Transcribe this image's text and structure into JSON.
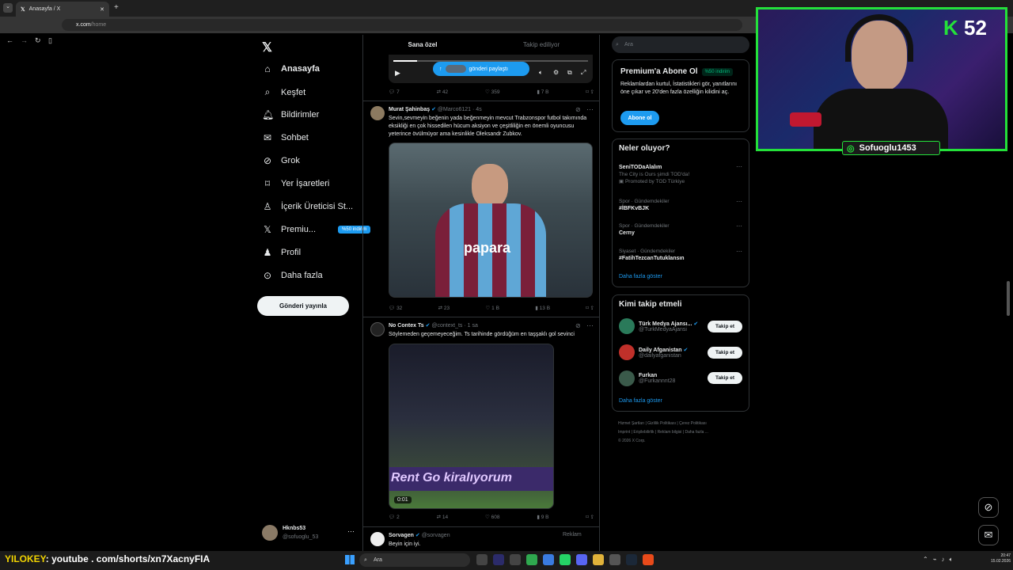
{
  "browser": {
    "tab_title": "Anasayfa / X",
    "url_host": "x.com",
    "url_path": "/home"
  },
  "nav": {
    "items": [
      {
        "label": "Anasayfa",
        "icon": "home-icon"
      },
      {
        "label": "Keşfet",
        "icon": "search-icon"
      },
      {
        "label": "Bildirimler",
        "icon": "bell-icon"
      },
      {
        "label": "Sohbet",
        "icon": "mail-icon"
      },
      {
        "label": "Grok",
        "icon": "grok-icon"
      },
      {
        "label": "Yer İşaretleri",
        "icon": "bookmark-icon"
      },
      {
        "label": "İçerik Üreticisi St...",
        "icon": "creator-icon"
      },
      {
        "label": "Premiu...",
        "icon": "x-logo-icon",
        "badge": "%50 indirim"
      },
      {
        "label": "Profil",
        "icon": "person-icon"
      },
      {
        "label": "Daha fazla",
        "icon": "more-circle-icon"
      }
    ],
    "post_button": "Gönderi yayınla",
    "account": {
      "name": "Hknbs53",
      "handle": "@sofuoglu_53"
    }
  },
  "feed": {
    "tabs": [
      "Sana özel",
      "Takip ediliyor"
    ],
    "share_pill": "gönderi paylaştı",
    "post0_actions": {
      "replies": "7",
      "reposts": "42",
      "likes": "359",
      "views": "7 B"
    },
    "post1": {
      "name": "Murat Şahinbaş",
      "handle": "@Marco6121",
      "time": "4s",
      "text": "Sevin,sevmeyin beğenin yada beğenmeyin mevcut Trabzonspor futbol takımında eksikliği en çok hissedilen hücum aksiyon ve çeşitliliğin en önemli oyuncusu yeterince övülmüyor ama kesinlikle Oleksandr Zubkov.",
      "jersey_text": "papara",
      "actions": {
        "replies": "32",
        "reposts": "23",
        "likes": "1 B",
        "views": "13 B"
      }
    },
    "post2": {
      "name": "No Contex Ts",
      "handle": "@context_ts",
      "time": "1 sa",
      "text": "Söylemeden geçemeyeceğim. Ts tarihinde gördüğüm en taşşaklı gol sevinci",
      "video_time": "0:01",
      "banner_text": "Rent Go  kiralıyorum",
      "actions": {
        "replies": "2",
        "reposts": "14",
        "likes": "608",
        "views": "9 B"
      }
    },
    "post3": {
      "name": "Sorvagen",
      "handle": "@sorvagen",
      "tag": "Reklam",
      "text": "Beyin için iyi."
    }
  },
  "right": {
    "search_placeholder": "Ara",
    "premium": {
      "title": "Premium'a Abone Ol",
      "badge": "%50 indirim",
      "text": "Reklamlardan kurtul, İstatistikleri gör, yanıtlarını öne çıkar ve 20'den fazla özelliğin kilidini aç.",
      "button": "Abone ol"
    },
    "trends_title": "Neler oluyor?",
    "promoted": {
      "title": "SeniTODaAlalım",
      "sub": "The City is Ours şimdi TOD'da!",
      "meta": "Promoted by TOD Türkiye"
    },
    "trends": [
      {
        "meta": "Spor · Gündemdekiler",
        "title": "#İBFKvBJK"
      },
      {
        "meta": "Spor · Gündemdekiler",
        "title": "Cerny"
      },
      {
        "meta": "Siyaset · Gündemdekiler",
        "title": "#FatihTezcanTutuklansın"
      }
    ],
    "trends_more": "Daha fazla göster",
    "wtf_title": "Kimi takip etmeli",
    "wtf": [
      {
        "name": "Türk Medya Ajansı...",
        "handle": "@TurkMedyaAjansi",
        "color": "#2a7a5a"
      },
      {
        "name": "Daily Afganistan",
        "handle": "@dailyafganistan",
        "color": "#c0302a"
      },
      {
        "name": "Furkan",
        "handle": "@Furkannnt28",
        "color": "#3a5a4a"
      }
    ],
    "follow_label": "Takip et",
    "wtf_more": "Daha fazla göster",
    "footer": [
      "Hizmet Şartları",
      "Gizlilik Politikası",
      "Çerez Politikası",
      "Imprint",
      "Erişilebilirlik",
      "Reklam bilgisi",
      "Daha fazla ...",
      "© 2026 X Corp."
    ]
  },
  "stream": {
    "counter": "52",
    "instagram": "Sofuoglu1453",
    "overlay_prefix": "YILOKEY",
    "overlay_text": ": youtube . com/shorts/xn7XacnyFIA"
  },
  "taskbar": {
    "search": "Ara",
    "time": "20:47",
    "date": "15.02.2026"
  }
}
